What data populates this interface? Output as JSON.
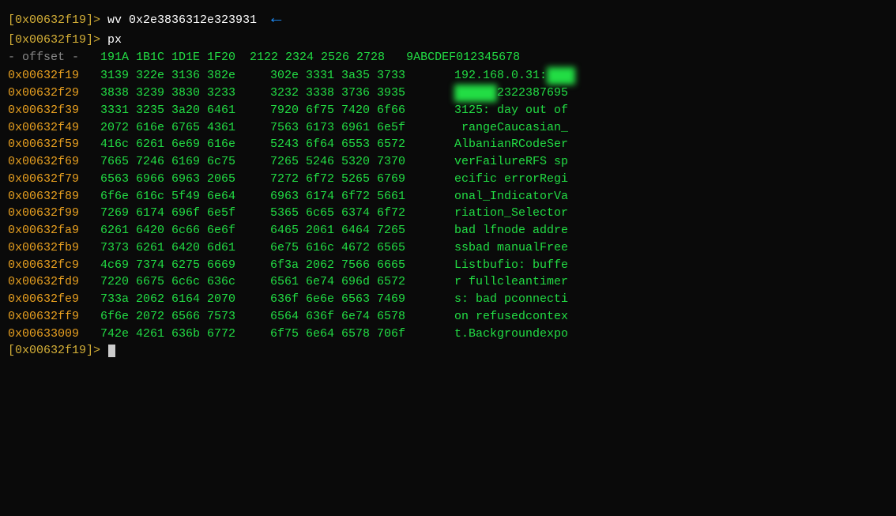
{
  "terminal": {
    "lines": [
      {
        "type": "command",
        "prompt": "[0x00632f19]> ",
        "cmd": "wv 0x2e3836312e323931",
        "arrow": true
      },
      {
        "type": "command",
        "prompt": "[0x00632f19]> ",
        "cmd": "px",
        "arrow": false
      }
    ],
    "header": {
      "label": "- offset -",
      "cols": " 191A 1B1C 1D1E 1F20  2122 2324 2526 2728   9ABCDEF012345678"
    },
    "rows": [
      {
        "addr": "0x00632f19",
        "hex": "3139 322e 3136 382e 302e 3331 3a35 3733",
        "ascii": "192.168.0.31:",
        "ascii_blur": true,
        "ascii_rest": ""
      },
      {
        "addr": "0x00632f29",
        "hex": "3838 3239 3830 3233 3232 3338 3736 3935",
        "ascii": "",
        "ascii_blur": true,
        "ascii_rest": "2322387695"
      },
      {
        "addr": "0x00632f39",
        "hex": "3331 3235 3a20 6461 7920 6f75 7420 6f66",
        "ascii": "3125: day out of",
        "ascii_blur": false,
        "ascii_rest": ""
      },
      {
        "addr": "0x00632f49",
        "hex": "2072 616e 6765 4361 7563 6173 6961 6e5f",
        "ascii": " rangeCaucasian_",
        "ascii_blur": false,
        "ascii_rest": ""
      },
      {
        "addr": "0x00632f59",
        "hex": "416c 6261 6e69 616e 5243 6f64 6553 6572",
        "ascii": "AlbanianRCodeSer",
        "ascii_blur": false,
        "ascii_rest": ""
      },
      {
        "addr": "0x00632f69",
        "hex": "7665 7246 6169 6c75 7265 5246 5320 7370",
        "ascii": "verFailureRFS sp",
        "ascii_blur": false,
        "ascii_rest": ""
      },
      {
        "addr": "0x00632f79",
        "hex": "6563 6966 6963 2065 7272 6f72 5265 6769",
        "ascii": "ecific errorRegi",
        "ascii_blur": false,
        "ascii_rest": ""
      },
      {
        "addr": "0x00632f89",
        "hex": "6f6e 616c 5f49 6e64 6963 6174 6f72 5661",
        "ascii": "onal_IndicatorVa",
        "ascii_blur": false,
        "ascii_rest": ""
      },
      {
        "addr": "0x00632f99",
        "hex": "7269 6174 696f 6e5f 5365 6c65 6374 6f72",
        "ascii": "riation_Selector",
        "ascii_blur": false,
        "ascii_rest": ""
      },
      {
        "addr": "0x00632fa9",
        "hex": "6261 6420 6c66 6e6f 6465 2061 6464 7265",
        "ascii": "bad lfnode addre",
        "ascii_blur": false,
        "ascii_rest": ""
      },
      {
        "addr": "0x00632fb9",
        "hex": "7373 6261 6420 6d61 6e75 616c 4672 6565",
        "ascii": "ssbad manualFree",
        "ascii_blur": false,
        "ascii_rest": ""
      },
      {
        "addr": "0x00632fc9",
        "hex": "4c69 7374 6275 6669 6f3a 2062 7566 6665",
        "ascii": "Listbufio: buffe",
        "ascii_blur": false,
        "ascii_rest": ""
      },
      {
        "addr": "0x00632fd9",
        "hex": "7220 6675 6c6c 636c 6561 6e74 696d 6572",
        "ascii": "r fullcleantimer",
        "ascii_blur": false,
        "ascii_rest": ""
      },
      {
        "addr": "0x00632fe9",
        "hex": "733a 2062 6164 2070 636f 6e6e 6563 7469",
        "ascii": "s: bad pconnecti",
        "ascii_blur": false,
        "ascii_rest": ""
      },
      {
        "addr": "0x00632ff9",
        "hex": "6f6e 2072 6566 7573 6564 636f 6e74 6578",
        "ascii": "on refusedcontex",
        "ascii_blur": false,
        "ascii_rest": ""
      },
      {
        "addr": "0x00633009",
        "hex": "742e 4261 636b 6772 6f75 6e64 6578 706f",
        "ascii": "t.Backgroundexpo",
        "ascii_blur": false,
        "ascii_rest": ""
      }
    ],
    "final_prompt": "[0x00632f19]> "
  }
}
